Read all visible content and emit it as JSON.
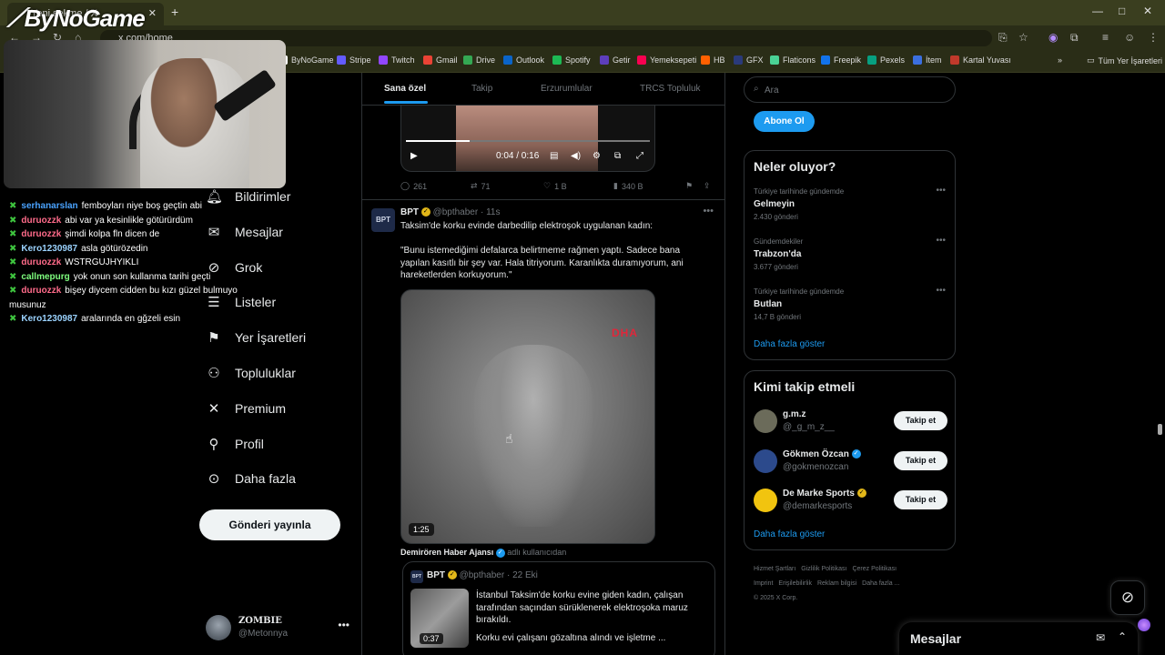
{
  "browser": {
    "tab_title": "Yeni sekme / X",
    "url": "x.com/home",
    "bookmarks": [
      {
        "label": "ByNoGame",
        "color": "#ffffff"
      },
      {
        "label": "Stripe",
        "color": "#635bff"
      },
      {
        "label": "Twitch",
        "color": "#9146ff"
      },
      {
        "label": "Gmail",
        "color": "#ea4335"
      },
      {
        "label": "Drive",
        "color": "#34a853"
      },
      {
        "label": "Outlook",
        "color": "#0a64c8"
      },
      {
        "label": "Spotify",
        "color": "#1db954"
      },
      {
        "label": "Getir",
        "color": "#5d3ebc"
      },
      {
        "label": "Yemeksepeti",
        "color": "#fa0050"
      },
      {
        "label": "HB",
        "color": "#ff6000"
      },
      {
        "label": "GFX",
        "color": "#2a3a7a"
      },
      {
        "label": "Flaticons",
        "color": "#4ad295"
      },
      {
        "label": "Freepik",
        "color": "#1273eb"
      },
      {
        "label": "Pexels",
        "color": "#07a081"
      },
      {
        "label": "İtem",
        "color": "#3b6fe0"
      },
      {
        "label": "Kartal Yuvası",
        "color": "#c0392b"
      }
    ],
    "all_bookmarks": "Tüm Yer İşaretleri"
  },
  "overlay": {
    "logo": "ByNoGame"
  },
  "chat": [
    {
      "user": "serhanarslan",
      "color": "#4aa3ff",
      "text": "femboyları niye boş geçtin abi"
    },
    {
      "user": "duruozzk",
      "color": "#ff6b8a",
      "text": "abi var ya kesinlikle götürürdüm"
    },
    {
      "user": "duruozzk",
      "color": "#ff6b8a",
      "text": "şimdi kolpa fln dicen de"
    },
    {
      "user": "Kero1230987",
      "color": "#9bd3ff",
      "text": "asla götürözedin"
    },
    {
      "user": "duruozzk",
      "color": "#ff6b8a",
      "text": "WSTRGUJHYIKLI"
    },
    {
      "user": "callmepurg",
      "color": "#7fff7f",
      "text": "yok onun son kullanma tarihi geçti"
    },
    {
      "user": "duruozzk",
      "color": "#ff6b8a",
      "text": "bişey diycem cidden bu kızı güzel bulmuyo musunuz"
    },
    {
      "user": "Kero1230987",
      "color": "#9bd3ff",
      "text": "aralarında en gğzeli esin"
    }
  ],
  "nav": {
    "items": [
      {
        "label": "Bildirimler",
        "icon": "bell-icon"
      },
      {
        "label": "Mesajlar",
        "icon": "envelope-icon"
      },
      {
        "label": "Grok",
        "icon": "grok-icon"
      },
      {
        "label": "Listeler",
        "icon": "list-icon"
      },
      {
        "label": "Yer İşaretleri",
        "icon": "bookmark-icon"
      },
      {
        "label": "Topluluklar",
        "icon": "people-icon"
      },
      {
        "label": "Premium",
        "icon": "x-icon"
      },
      {
        "label": "Profil",
        "icon": "person-icon"
      },
      {
        "label": "Daha fazla",
        "icon": "more-circle-icon"
      }
    ],
    "post_button": "Gönderi yayınla",
    "account": {
      "name": "ZOMBIE",
      "handle": "@Metonnya"
    }
  },
  "feed": {
    "tabs": [
      "Sana özel",
      "Takip",
      "Erzurumlular",
      "TRCS Topluluk"
    ],
    "video1": {
      "time": "0:04 / 0:16"
    },
    "tweet1_actions": {
      "replies": "261",
      "reposts": "71",
      "likes": "1 B",
      "views": "340 B"
    },
    "tweet2": {
      "avatar_text": "BPT",
      "name": "BPT",
      "handle": "@bpthaber",
      "time": "· 11s",
      "text1": "Taksim'de korku evinde darbedilip elektroşok uygulanan kadın:",
      "text2": "\"Bunu istemediğimi defalarca belirtmeme rağmen yaptı. Sadece bana yapılan kasıtlı bir şey var. Hala titriyorum. Karanlıkta duramıyorum, ani hareketlerden korkuyorum.\"",
      "video_logo": "DHA",
      "video_duration": "1:25",
      "credit_name": "Demirören Haber Ajansı",
      "credit_rest": "adlı kullanıcıdan"
    },
    "quote": {
      "name": "BPT",
      "handle": "@bpthaber",
      "time": "· 22 Eki",
      "thumb_duration": "0:37",
      "text1": "İstanbul Taksim'de korku evine giden kadın, çalışan tarafından saçından sürüklenerek elektroşoka maruz bırakıldı.",
      "text2": "Korku evi çalışanı gözaltına alındı ve işletme ..."
    }
  },
  "sidebar": {
    "search_placeholder": "Ara",
    "subscribe": "Abone Ol",
    "trends_title": "Neler oluyor?",
    "trends": [
      {
        "context": "Türkiye tarihinde gündemde",
        "name": "Gelmeyin",
        "posts": "2.430 gönderi"
      },
      {
        "context": "Gündemdekiler",
        "name": "Trabzon'da",
        "posts": "3.677 gönderi"
      },
      {
        "context": "Türkiye tarihinde gündemde",
        "name": "Butlan",
        "posts": "14,7 B gönderi"
      }
    ],
    "show_more": "Daha fazla göster",
    "follow_title": "Kimi takip etmeli",
    "follow": [
      {
        "name": "g.m.z",
        "handle": "@_g_m_z__",
        "verified": false,
        "avatar_color": "#6b6b5a"
      },
      {
        "name": "Gökmen Özcan",
        "handle": "@gokmenozcan",
        "verified": true,
        "avatar_color": "#2c4a8c"
      },
      {
        "name": "De Marke Sports",
        "handle": "@demarkesports",
        "verified": true,
        "avatar_color": "#f1c40f"
      }
    ],
    "follow_button": "Takip et",
    "footer": [
      "Hizmet Şartları",
      "Gizlilik Politikası",
      "Çerez Politikası",
      "Imprint",
      "Erişilebilirlik",
      "Reklam bilgisi",
      "Daha fazla ...",
      "© 2025 X Corp."
    ]
  },
  "dock": {
    "title": "Mesajlar"
  }
}
